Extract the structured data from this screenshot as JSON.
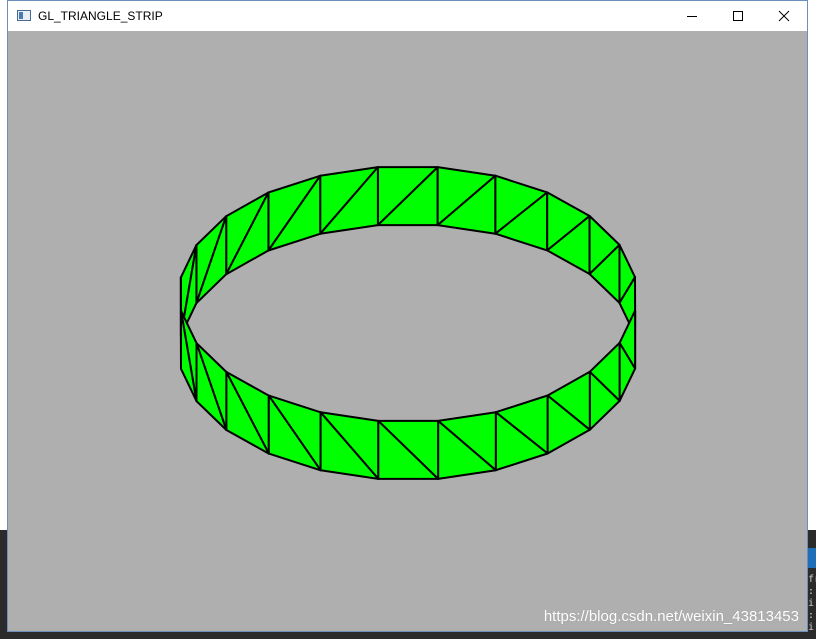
{
  "window": {
    "title": "GL_TRIANGLE_STRIP",
    "controls": [
      "minimize",
      "maximize",
      "close"
    ]
  },
  "scene": {
    "background_color": "#afafaf",
    "fill_color": "#00ff00",
    "edge_color": "#000000",
    "primitive": "triangle-strip ring"
  },
  "watermark": "https://blog.csdn.net/weixin_43813453",
  "desktop": {
    "side_text": "fr\n:\ni\n:\ni"
  }
}
